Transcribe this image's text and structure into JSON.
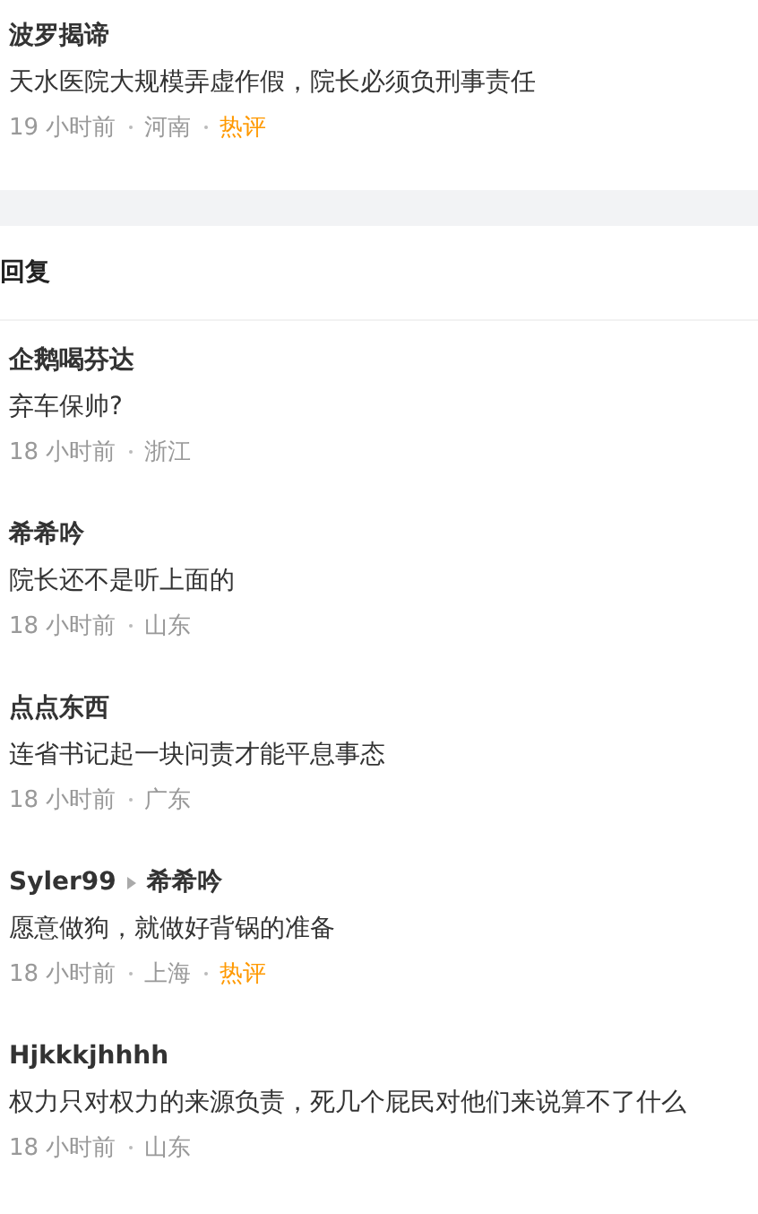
{
  "top_comment": {
    "author": "波罗揭谛",
    "text": "天水医院大规模弄虚作假，院长必须负刑事责任",
    "time": "19 小时前",
    "location": "河南",
    "tag": "热评"
  },
  "replies_header": {
    "title": "回复"
  },
  "replies": [
    {
      "author": "企鹅喝芬达",
      "text": "弃车保帅?",
      "time": "18 小时前",
      "location": "浙江"
    },
    {
      "author": "希希吟",
      "text": "院长还不是听上面的",
      "time": "18 小时前",
      "location": "山东"
    },
    {
      "author": "点点东西",
      "text": "连省书记起一块问责才能平息事态",
      "time": "18 小时前",
      "location": "广东"
    },
    {
      "author": "Syler99",
      "reply_to": "希希吟",
      "text": "愿意做狗，就做好背锅的准备",
      "time": "18 小时前",
      "location": "上海",
      "tag": "热评"
    },
    {
      "author": "Hjkkkjhhhh",
      "text": "权力只对权力的来源负责，死几个屁民对他们来说算不了什么",
      "time": "18 小时前",
      "location": "山东"
    }
  ]
}
